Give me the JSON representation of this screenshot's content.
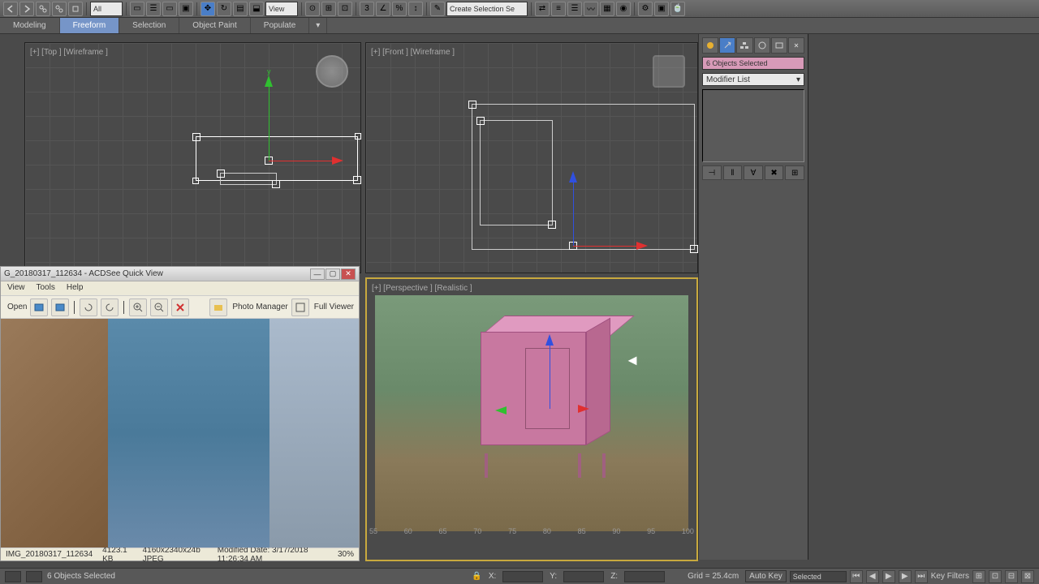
{
  "toolbar": {
    "all_dropdown": "All",
    "view_dropdown": "View",
    "selection_set": "Create Selection Se"
  },
  "ribbon": {
    "tabs": [
      "Modeling",
      "Freeform",
      "Selection",
      "Object Paint",
      "Populate"
    ]
  },
  "viewports": {
    "top": "[+] [Top ] [Wireframe ]",
    "front": "[+] [Front ] [Wireframe ]",
    "persp": "[+] [Perspective ] [Realistic ]"
  },
  "command_panel": {
    "selection_label": "6 Objects Selected",
    "modifier_list": "Modifier List"
  },
  "timeline": {
    "ticks": [
      "55",
      "60",
      "65",
      "70",
      "75",
      "80",
      "85",
      "90",
      "95",
      "100"
    ]
  },
  "status": {
    "selection": "6 Objects Selected",
    "x_label": "X:",
    "y_label": "Y:",
    "z_label": "Z:",
    "grid": "Grid = 25.4cm",
    "auto_key": "Auto Key",
    "selected": "Selected",
    "key_filters": "Key Filters"
  },
  "acdsee": {
    "title": "G_20180317_112634 - ACDSee Quick View",
    "menu": [
      "View",
      "Tools",
      "Help"
    ],
    "open": "Open",
    "photo_manager": "Photo Manager",
    "full_viewer": "Full Viewer",
    "status_file": "IMG_20180317_112634",
    "status_size": "4123.1 KB",
    "status_dims": "4160x2340x24b JPEG",
    "status_date": "Modified Date: 3/17/2018 11:26:34 AM",
    "status_zoom": "30%"
  }
}
